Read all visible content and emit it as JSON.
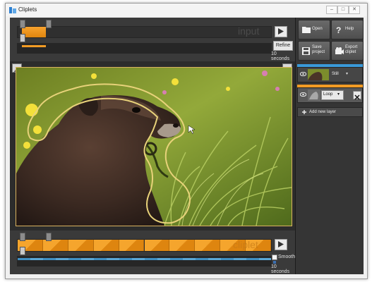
{
  "window": {
    "title": "Cliplets",
    "controls": [
      "–",
      "□",
      "✕"
    ]
  },
  "input_bar": {
    "label": "input",
    "refine_label": "Refine",
    "duration": "10 seconds"
  },
  "cliplet_bar": {
    "label": "cliplet",
    "smooth_label": "Smooth",
    "smooth_checked": true,
    "duration": "10 seconds",
    "segment_count": 10
  },
  "sidebar": {
    "open_label": "Open",
    "help_label": "Help",
    "save_label_1": "Save",
    "save_label_2": "project",
    "export_label_1": "Export",
    "export_label_2": "cliplet",
    "layers": [
      {
        "name": "Still",
        "selected": false
      },
      {
        "name": "Loop",
        "selected": true
      }
    ],
    "add_layer_label": "Add new layer"
  },
  "colors": {
    "accent_orange": "#f29b24",
    "layer_selected_bar": "#f29b24",
    "still_layer_bar": "#3a9ad9",
    "mask_outline": "#e8d27a"
  },
  "icons": {
    "play": "play-icon",
    "open": "folder-icon",
    "help": "question-icon",
    "save": "floppy-icon",
    "export": "film-icon",
    "eye": "eye-icon",
    "close": "close-icon"
  }
}
